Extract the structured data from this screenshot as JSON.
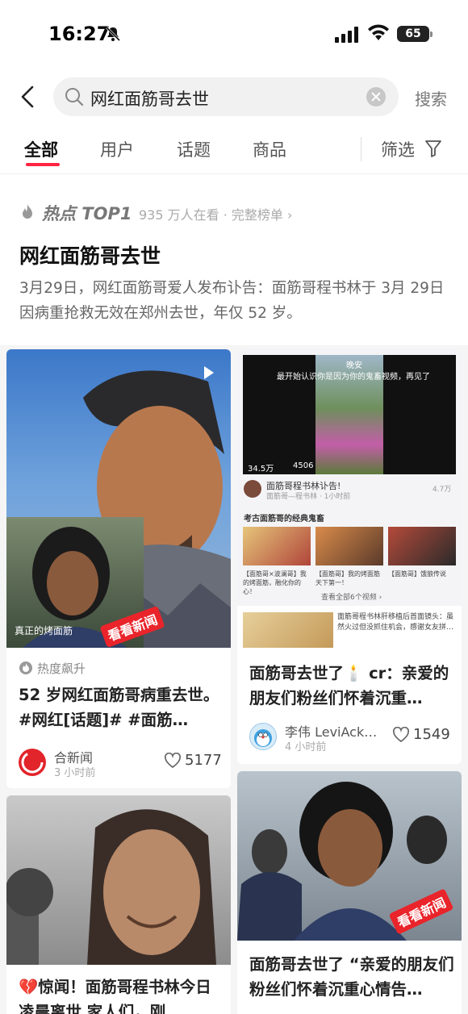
{
  "status_bar": {
    "time": "16:27",
    "battery": "65"
  },
  "search": {
    "query": "网红面筋哥去世",
    "search_button": "搜索"
  },
  "tabs": [
    {
      "label": "全部",
      "active": true
    },
    {
      "label": "用户"
    },
    {
      "label": "话题"
    },
    {
      "label": "商品"
    }
  ],
  "filter_label": "筛选",
  "hot": {
    "label": "热点 TOP1",
    "meta": "935 万人在看 · 完整榜单 ›",
    "title": "网红面筋哥去世",
    "description": "3月29日，网红面筋哥爱人发布讣告：面筋哥程书林于 3月 29日因病重抢救无效在郑州去世，年仅 52 岁。"
  },
  "cards": [
    {
      "badge": "热度飙升",
      "title": "52 岁网红面筋哥病重去世。 #网红[话题]# #面筋…",
      "author": "合新闻",
      "time": "3 小时前",
      "likes": "5177",
      "image_caption": "真正的烤面筋",
      "watermark": "看看新闻"
    },
    {
      "title": "面筋哥去世了🕯️ cr：亲爱的朋友们粉丝们怀着沉重…",
      "author": "李伟 LeviAck…",
      "time": "4 小时前",
      "likes": "1549",
      "screenshot": {
        "video_caption_1": "晚安",
        "video_caption_2": "最开始认识你是因为你的鬼畜视频，再见了",
        "views": "34.5万",
        "comments": "4506",
        "post_title": "面筋哥程书林讣告!",
        "post_sub": "面筋哥—程书林 · 1小时前",
        "post_likes": "4.7万",
        "section_title": "考古面筋哥的经典鬼畜",
        "thumb_1": "【面筋哥×波澜哥】我的烤面筋，融化你的心！",
        "thumb_2": "【面筋哥】我的烤面筋天下第一！",
        "thumb_3": "【面筋哥】饿狼传说",
        "view_all": "查看全部6个视频 ›",
        "related": "面筋哥程书林肝移植后首面镜头：虽然火过但没抓住机会，感谢女友拼…"
      }
    },
    {
      "title": "💔惊闻！面筋哥程书林今日凌晨离世 家人们，刚…"
    },
    {
      "title": "面筋哥去世了 “亲爱的朋友们粉丝们怀着沉重心情告…",
      "watermark": "看看新闻"
    }
  ],
  "colors": {
    "accent": "#ff2442",
    "muted": "#777777"
  }
}
